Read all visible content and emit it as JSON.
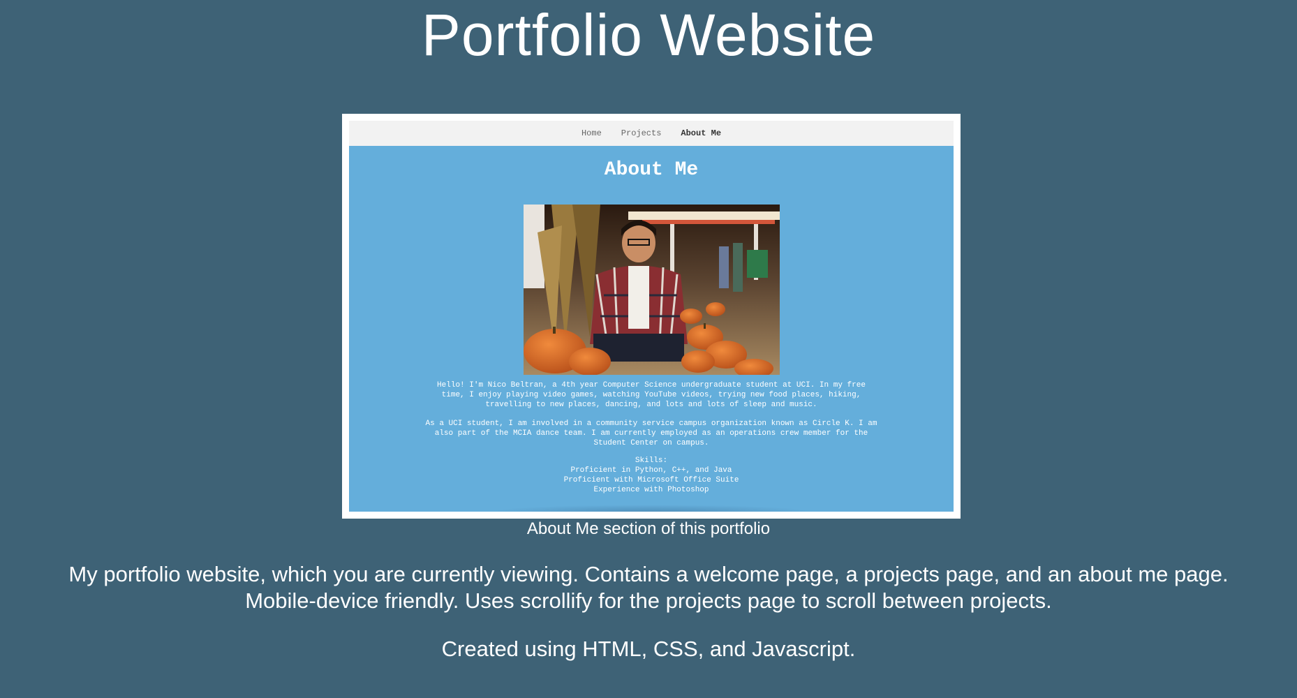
{
  "page": {
    "title": "Portfolio Website",
    "background_color": "#3e6276"
  },
  "screenshot": {
    "nav": {
      "items": [
        {
          "label": "Home"
        },
        {
          "label": "Projects"
        },
        {
          "label": "About Me"
        }
      ],
      "active": "About Me"
    },
    "heading": "About Me",
    "bio_paragraph_1_line_1": "Hello! I'm Nico Beltran, a 4th year Computer Science undergraduate student at UCI. In my free",
    "bio_paragraph_1_line_2": "time, I enjoy playing video games, watching YouTube videos, trying new food places, hiking,",
    "bio_paragraph_1_line_3": "travelling to new places, dancing, and lots and lots of sleep and music.",
    "bio_paragraph_2_line_1": "As a UCI student, I am involved in a community service campus organization known as Circle K. I am",
    "bio_paragraph_2_line_2": "also part of the MCIA dance team. I am currently employed as an operations crew member for the",
    "bio_paragraph_2_line_3": "Student Center on campus.",
    "skills_title": "Skills:",
    "skills": [
      "Proficient in Python, C++, and Java",
      "Proficient with Microsoft Office Suite",
      "Experience with Photoshop"
    ],
    "background_color": "#64aedb"
  },
  "caption": "About Me section of this portfolio",
  "description_line_1": "My portfolio website, which you are currently viewing. Contains a welcome page, a projects page, and an about me page.",
  "description_line_2": "Mobile-device friendly. Uses scrollify for the projects page to scroll between projects.",
  "tech_line": "Created using HTML, CSS, and Javascript."
}
